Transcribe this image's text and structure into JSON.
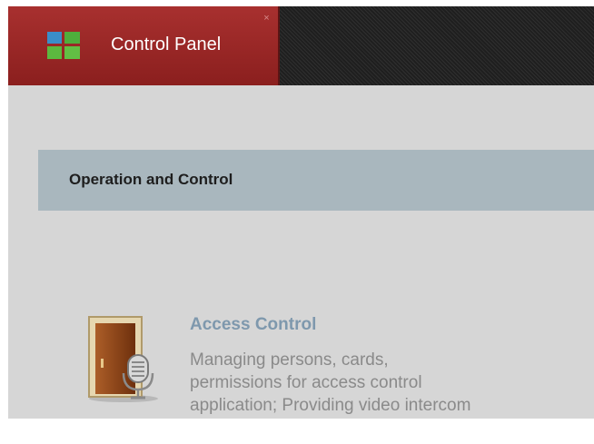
{
  "tab": {
    "label": "Control Panel",
    "icon": "grid-icon",
    "close_icon": "×"
  },
  "section": {
    "title": "Operation and Control"
  },
  "modules": [
    {
      "title": "Access Control",
      "icon": "door-intercom-icon",
      "description_lines": [
        "Managing persons, cards,",
        "permissions for access control",
        "application; Providing video intercom"
      ]
    }
  ],
  "colors": {
    "tab_background": "#9b2928",
    "topbar_background": "#2a2a2a",
    "section_header": "#a9b7be",
    "module_title": "#7e98ad",
    "module_description": "#8a8a8a"
  }
}
